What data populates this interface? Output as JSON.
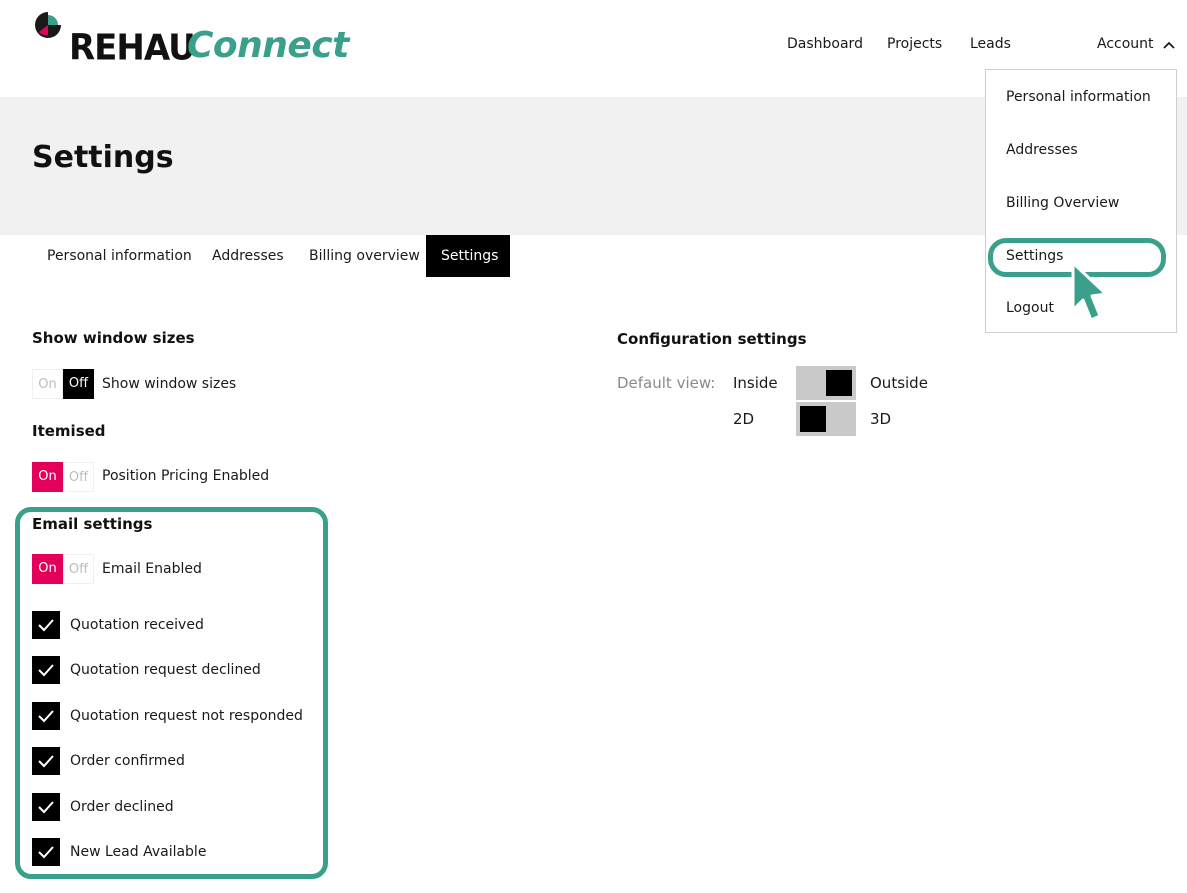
{
  "brand": {
    "name": "REHAU",
    "product": "Connect",
    "accent": "#3aa08b",
    "pink": "#e2005a"
  },
  "nav": {
    "dashboard": "Dashboard",
    "projects": "Projects",
    "leads": "Leads",
    "account": "Account"
  },
  "account_menu": {
    "items": [
      "Personal information",
      "Addresses",
      "Billing Overview",
      "Settings",
      "Logout"
    ],
    "highlighted": "Settings"
  },
  "page": {
    "title": "Settings"
  },
  "tabs": [
    {
      "label": "Personal information",
      "active": false
    },
    {
      "label": "Addresses",
      "active": false
    },
    {
      "label": "Billing overview",
      "active": false
    },
    {
      "label": "Settings",
      "active": true
    }
  ],
  "show_window_sizes": {
    "heading": "Show window sizes",
    "toggle": {
      "on": "On",
      "off": "Off",
      "state": "off"
    },
    "label": "Show window sizes"
  },
  "itemised": {
    "heading": "Itemised",
    "toggle": {
      "on": "On",
      "off": "Off",
      "state": "on"
    },
    "label": "Position Pricing Enabled"
  },
  "email_settings": {
    "heading": "Email settings",
    "toggle": {
      "on": "On",
      "off": "Off",
      "state": "on"
    },
    "label": "Email Enabled",
    "checkboxes": [
      {
        "label": "Quotation received",
        "checked": true
      },
      {
        "label": "Quotation request declined",
        "checked": true
      },
      {
        "label": "Quotation request not responded",
        "checked": true
      },
      {
        "label": "Order confirmed",
        "checked": true
      },
      {
        "label": "Order declined",
        "checked": true
      },
      {
        "label": "New Lead Available",
        "checked": true
      }
    ]
  },
  "configuration": {
    "heading": "Configuration settings",
    "default_view_label": "Default view:",
    "view_switch": {
      "left": "Inside",
      "right": "Outside",
      "selected": "Outside"
    },
    "dimension_switch": {
      "left": "2D",
      "right": "3D",
      "selected": "2D"
    }
  }
}
